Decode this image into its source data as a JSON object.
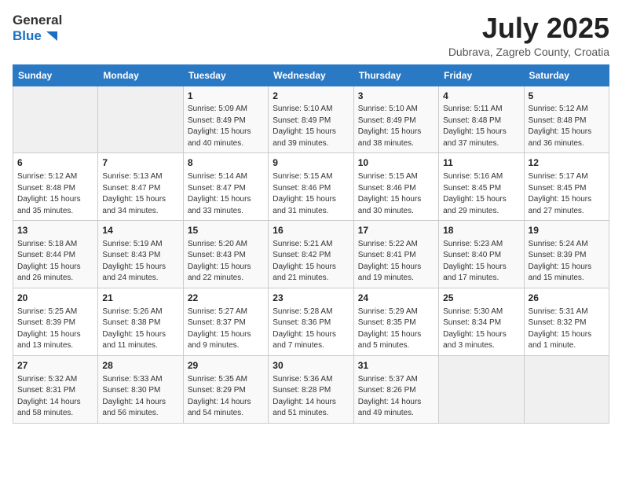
{
  "header": {
    "logo_general": "General",
    "logo_blue": "Blue",
    "month": "July 2025",
    "location": "Dubrava, Zagreb County, Croatia"
  },
  "days_of_week": [
    "Sunday",
    "Monday",
    "Tuesday",
    "Wednesday",
    "Thursday",
    "Friday",
    "Saturday"
  ],
  "weeks": [
    [
      {
        "day": "",
        "sunrise": "",
        "sunset": "",
        "daylight": ""
      },
      {
        "day": "",
        "sunrise": "",
        "sunset": "",
        "daylight": ""
      },
      {
        "day": "1",
        "sunrise": "Sunrise: 5:09 AM",
        "sunset": "Sunset: 8:49 PM",
        "daylight": "Daylight: 15 hours and 40 minutes."
      },
      {
        "day": "2",
        "sunrise": "Sunrise: 5:10 AM",
        "sunset": "Sunset: 8:49 PM",
        "daylight": "Daylight: 15 hours and 39 minutes."
      },
      {
        "day": "3",
        "sunrise": "Sunrise: 5:10 AM",
        "sunset": "Sunset: 8:49 PM",
        "daylight": "Daylight: 15 hours and 38 minutes."
      },
      {
        "day": "4",
        "sunrise": "Sunrise: 5:11 AM",
        "sunset": "Sunset: 8:48 PM",
        "daylight": "Daylight: 15 hours and 37 minutes."
      },
      {
        "day": "5",
        "sunrise": "Sunrise: 5:12 AM",
        "sunset": "Sunset: 8:48 PM",
        "daylight": "Daylight: 15 hours and 36 minutes."
      }
    ],
    [
      {
        "day": "6",
        "sunrise": "Sunrise: 5:12 AM",
        "sunset": "Sunset: 8:48 PM",
        "daylight": "Daylight: 15 hours and 35 minutes."
      },
      {
        "day": "7",
        "sunrise": "Sunrise: 5:13 AM",
        "sunset": "Sunset: 8:47 PM",
        "daylight": "Daylight: 15 hours and 34 minutes."
      },
      {
        "day": "8",
        "sunrise": "Sunrise: 5:14 AM",
        "sunset": "Sunset: 8:47 PM",
        "daylight": "Daylight: 15 hours and 33 minutes."
      },
      {
        "day": "9",
        "sunrise": "Sunrise: 5:15 AM",
        "sunset": "Sunset: 8:46 PM",
        "daylight": "Daylight: 15 hours and 31 minutes."
      },
      {
        "day": "10",
        "sunrise": "Sunrise: 5:15 AM",
        "sunset": "Sunset: 8:46 PM",
        "daylight": "Daylight: 15 hours and 30 minutes."
      },
      {
        "day": "11",
        "sunrise": "Sunrise: 5:16 AM",
        "sunset": "Sunset: 8:45 PM",
        "daylight": "Daylight: 15 hours and 29 minutes."
      },
      {
        "day": "12",
        "sunrise": "Sunrise: 5:17 AM",
        "sunset": "Sunset: 8:45 PM",
        "daylight": "Daylight: 15 hours and 27 minutes."
      }
    ],
    [
      {
        "day": "13",
        "sunrise": "Sunrise: 5:18 AM",
        "sunset": "Sunset: 8:44 PM",
        "daylight": "Daylight: 15 hours and 26 minutes."
      },
      {
        "day": "14",
        "sunrise": "Sunrise: 5:19 AM",
        "sunset": "Sunset: 8:43 PM",
        "daylight": "Daylight: 15 hours and 24 minutes."
      },
      {
        "day": "15",
        "sunrise": "Sunrise: 5:20 AM",
        "sunset": "Sunset: 8:43 PM",
        "daylight": "Daylight: 15 hours and 22 minutes."
      },
      {
        "day": "16",
        "sunrise": "Sunrise: 5:21 AM",
        "sunset": "Sunset: 8:42 PM",
        "daylight": "Daylight: 15 hours and 21 minutes."
      },
      {
        "day": "17",
        "sunrise": "Sunrise: 5:22 AM",
        "sunset": "Sunset: 8:41 PM",
        "daylight": "Daylight: 15 hours and 19 minutes."
      },
      {
        "day": "18",
        "sunrise": "Sunrise: 5:23 AM",
        "sunset": "Sunset: 8:40 PM",
        "daylight": "Daylight: 15 hours and 17 minutes."
      },
      {
        "day": "19",
        "sunrise": "Sunrise: 5:24 AM",
        "sunset": "Sunset: 8:39 PM",
        "daylight": "Daylight: 15 hours and 15 minutes."
      }
    ],
    [
      {
        "day": "20",
        "sunrise": "Sunrise: 5:25 AM",
        "sunset": "Sunset: 8:39 PM",
        "daylight": "Daylight: 15 hours and 13 minutes."
      },
      {
        "day": "21",
        "sunrise": "Sunrise: 5:26 AM",
        "sunset": "Sunset: 8:38 PM",
        "daylight": "Daylight: 15 hours and 11 minutes."
      },
      {
        "day": "22",
        "sunrise": "Sunrise: 5:27 AM",
        "sunset": "Sunset: 8:37 PM",
        "daylight": "Daylight: 15 hours and 9 minutes."
      },
      {
        "day": "23",
        "sunrise": "Sunrise: 5:28 AM",
        "sunset": "Sunset: 8:36 PM",
        "daylight": "Daylight: 15 hours and 7 minutes."
      },
      {
        "day": "24",
        "sunrise": "Sunrise: 5:29 AM",
        "sunset": "Sunset: 8:35 PM",
        "daylight": "Daylight: 15 hours and 5 minutes."
      },
      {
        "day": "25",
        "sunrise": "Sunrise: 5:30 AM",
        "sunset": "Sunset: 8:34 PM",
        "daylight": "Daylight: 15 hours and 3 minutes."
      },
      {
        "day": "26",
        "sunrise": "Sunrise: 5:31 AM",
        "sunset": "Sunset: 8:32 PM",
        "daylight": "Daylight: 15 hours and 1 minute."
      }
    ],
    [
      {
        "day": "27",
        "sunrise": "Sunrise: 5:32 AM",
        "sunset": "Sunset: 8:31 PM",
        "daylight": "Daylight: 14 hours and 58 minutes."
      },
      {
        "day": "28",
        "sunrise": "Sunrise: 5:33 AM",
        "sunset": "Sunset: 8:30 PM",
        "daylight": "Daylight: 14 hours and 56 minutes."
      },
      {
        "day": "29",
        "sunrise": "Sunrise: 5:35 AM",
        "sunset": "Sunset: 8:29 PM",
        "daylight": "Daylight: 14 hours and 54 minutes."
      },
      {
        "day": "30",
        "sunrise": "Sunrise: 5:36 AM",
        "sunset": "Sunset: 8:28 PM",
        "daylight": "Daylight: 14 hours and 51 minutes."
      },
      {
        "day": "31",
        "sunrise": "Sunrise: 5:37 AM",
        "sunset": "Sunset: 8:26 PM",
        "daylight": "Daylight: 14 hours and 49 minutes."
      },
      {
        "day": "",
        "sunrise": "",
        "sunset": "",
        "daylight": ""
      },
      {
        "day": "",
        "sunrise": "",
        "sunset": "",
        "daylight": ""
      }
    ]
  ]
}
